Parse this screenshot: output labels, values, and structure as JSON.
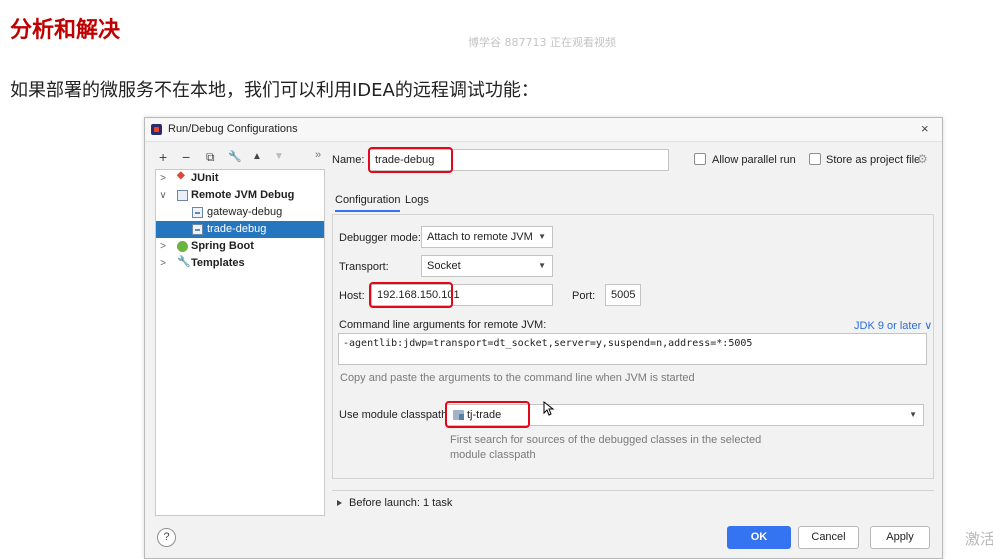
{
  "slide": {
    "title": "分析和解决",
    "watermark": "博学谷 887713 正在观看视频",
    "body_text": "如果部署的微服务不在本地，我们可以利用IDEA的远程调试功能：",
    "corner_text": "激活"
  },
  "dialog": {
    "title": "Run/Debug Configurations",
    "close": "×",
    "toolbar": {
      "add": "+",
      "remove": "−",
      "copy": "⧉",
      "edit": "🔧",
      "up": "▲",
      "down": "▼",
      "more": "»"
    },
    "tree": {
      "items": [
        {
          "label": "JUnit",
          "chevron": ">",
          "icon": "junit-icon"
        },
        {
          "label": "Remote JVM Debug",
          "chevron": "∨",
          "icon": "remote-jvm-icon"
        },
        {
          "label": "gateway-debug",
          "chevron": "",
          "icon": "config-icon"
        },
        {
          "label": "trade-debug",
          "chevron": "",
          "icon": "config-icon",
          "selected": true
        },
        {
          "label": "Spring Boot",
          "chevron": ">",
          "icon": "spring-icon"
        },
        {
          "label": "Templates",
          "chevron": ">",
          "icon": "wrench-icon"
        }
      ]
    },
    "name_label": "Name:",
    "name_value": "trade-debug",
    "allow_parallel": "Allow parallel run",
    "store_as_project": "Store as project file",
    "tabs": [
      "Configuration",
      "Logs"
    ],
    "config": {
      "debugger_mode_label": "Debugger mode:",
      "debugger_mode_value": "Attach to remote JVM",
      "transport_label": "Transport:",
      "transport_value": "Socket",
      "host_label": "Host:",
      "host_value": "192.168.150.101",
      "port_label": "Port:",
      "port_value": "5005",
      "cmd_label": "Command line arguments for remote JVM:",
      "jdk_link": "JDK 9 or later ∨",
      "cmd_value": "-agentlib:jdwp=transport=dt_socket,server=y,suspend=n,address=*:5005",
      "cmd_hint": "Copy and paste the arguments to the command line when JVM is started",
      "module_label": "Use module classpath:",
      "module_value": "tj-trade",
      "module_hint_1": "First search for sources of the debugged classes in the selected",
      "module_hint_2": "module classpath"
    },
    "before_launch": "Before launch: 1 task",
    "help": "?",
    "buttons": {
      "ok": "OK",
      "cancel": "Cancel",
      "apply": "Apply"
    },
    "colors": {
      "highlight": "#e3071a",
      "selection": "#2675bf",
      "primary": "#3574f0"
    }
  }
}
